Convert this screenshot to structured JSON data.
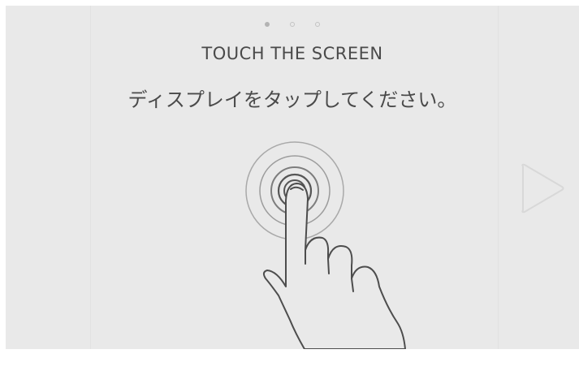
{
  "onboarding": {
    "page_indicator": {
      "total_pages": 3,
      "current_page": 1
    },
    "title": "TOUCH THE SCREEN",
    "subtitle": "ディスプレイをタップしてください。",
    "illustration_icon": "finger-tap-icon",
    "next_icon": "play-arrow-icon"
  },
  "colors": {
    "background": "#e9e9e9",
    "text": "#4a4a4a",
    "line_art": "#555555",
    "ripple": "#9a9a9a"
  }
}
